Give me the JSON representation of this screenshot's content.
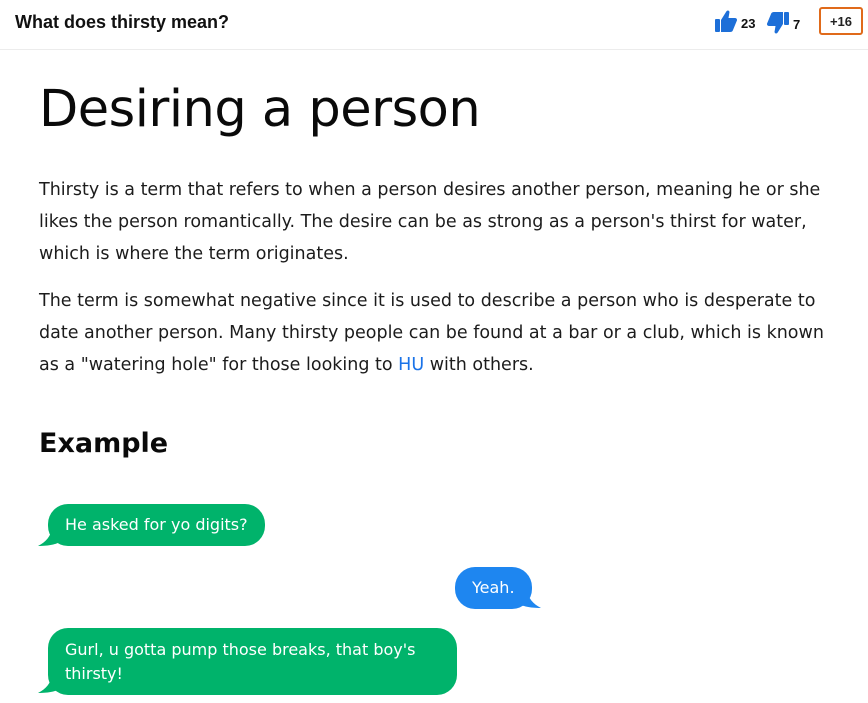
{
  "header": {
    "title": "What does thirsty mean?",
    "upvotes": "23",
    "downvotes": "7",
    "plus_count": "+16"
  },
  "article": {
    "title": "Desiring a person",
    "paragraph1": "Thirsty is a term that refers to when a person desires another person, meaning he or she likes the person romantically. The desire can be as strong as a person's thirst for water, which is where the term originates.",
    "paragraph2_before": "The term is somewhat negative since it is used to describe a person who is desperate to date another person. Many thirsty people can be found at a bar or a club, which is known as a \"watering hole\" for those looking to ",
    "paragraph2_link": "HU",
    "paragraph2_after": " with others.",
    "example_heading": "Example"
  },
  "messages": [
    {
      "text": "He asked for yo digits?",
      "side": "left",
      "color": "#00b36b"
    },
    {
      "text": "Yeah.",
      "side": "right",
      "color": "#1e86f0"
    },
    {
      "text": "Gurl, u gotta pump those breaks, that boy's thirsty!",
      "side": "left",
      "color": "#00b36b"
    }
  ],
  "colors": {
    "accent_blue": "#1a73e8",
    "thumb_icon": "#1d6fd8",
    "plus_border": "#e06a1a"
  },
  "icons": {
    "upvote": "thumbs-up-icon",
    "downvote": "thumbs-down-icon"
  }
}
